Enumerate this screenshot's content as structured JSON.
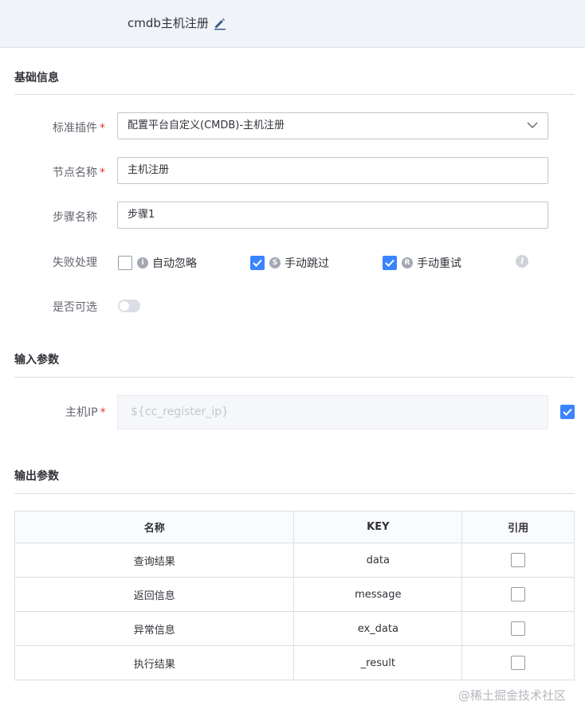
{
  "header": {
    "title": "cmdb主机注册"
  },
  "basic": {
    "section_title": "基础信息",
    "plugin_label": "标准插件",
    "plugin_value": "配置平台自定义(CMDB)-主机注册",
    "node_name_label": "节点名称",
    "node_name_value": "主机注册",
    "step_name_label": "步骤名称",
    "step_name_value": "步骤1",
    "failure_label": "失败处理",
    "failure_options": [
      {
        "badge": "i",
        "label": "自动忽略",
        "checked": false
      },
      {
        "badge": "S",
        "label": "手动跳过",
        "checked": true
      },
      {
        "badge": "R",
        "label": "手动重试",
        "checked": true
      }
    ],
    "optional_label": "是否可选",
    "required_mark": "*"
  },
  "input_params": {
    "section_title": "输入参数",
    "host_ip_label": "主机IP",
    "host_ip_value": "${cc_register_ip}",
    "host_ip_checked": true
  },
  "output_params": {
    "section_title": "输出参数",
    "columns": [
      "名称",
      "KEY",
      "引用"
    ],
    "rows": [
      {
        "name": "查询结果",
        "key": "data"
      },
      {
        "name": "返回信息",
        "key": "message"
      },
      {
        "name": "异常信息",
        "key": "ex_data"
      },
      {
        "name": "执行结果",
        "key": "_result"
      }
    ]
  },
  "watermark": "@稀土掘金技术社区",
  "colors": {
    "accent": "#3a84ff",
    "required": "#ea3636"
  }
}
